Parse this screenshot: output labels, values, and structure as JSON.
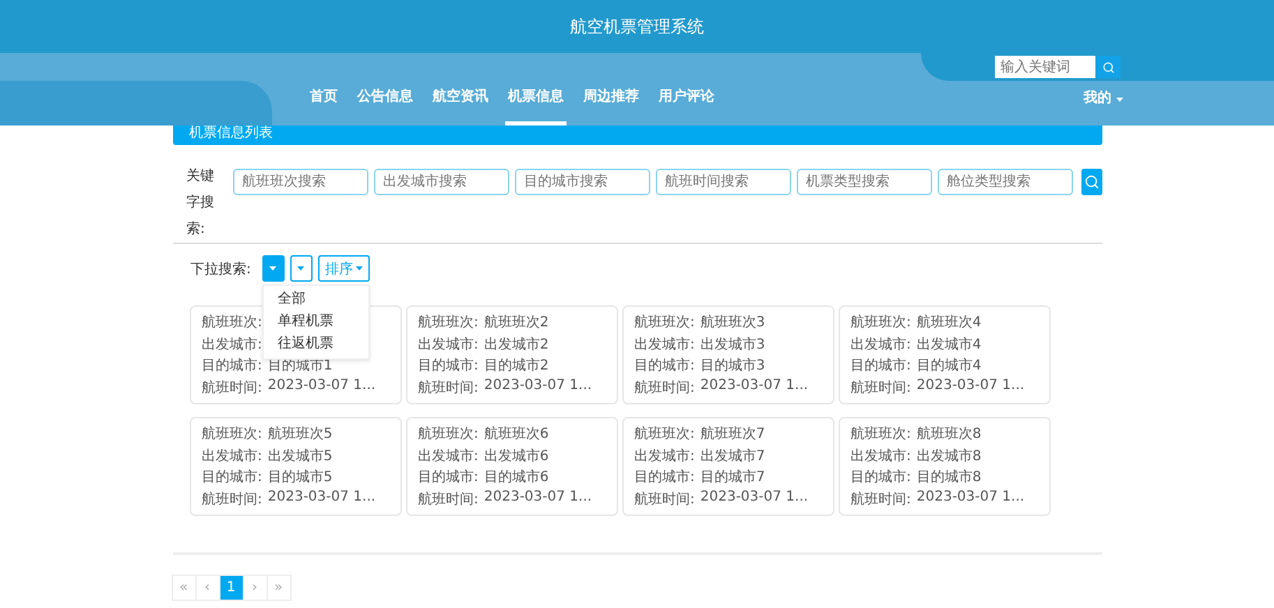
{
  "header": {
    "title": "航空机票管理系统"
  },
  "nav": {
    "items": [
      {
        "label": "首页",
        "selected": false
      },
      {
        "label": "公告信息",
        "selected": false
      },
      {
        "label": "航空资讯",
        "selected": false
      },
      {
        "label": "机票信息",
        "selected": true
      },
      {
        "label": "周边推荐",
        "selected": false
      },
      {
        "label": "用户评论",
        "selected": false
      }
    ],
    "search": {
      "placeholder": "输入关键词"
    },
    "user_menu": {
      "label": "我的"
    }
  },
  "panel": {
    "title": "机票信息列表"
  },
  "keyword_search": {
    "label": "关键字搜索:",
    "fields": [
      {
        "placeholder": "航班班次搜索"
      },
      {
        "placeholder": "出发城市搜索"
      },
      {
        "placeholder": "目的城市搜索"
      },
      {
        "placeholder": "航班时间搜索"
      },
      {
        "placeholder": "机票类型搜索"
      },
      {
        "placeholder": "舱位类型搜索"
      }
    ]
  },
  "dropdown_search": {
    "label": "下拉搜索:",
    "dropdowns": [
      {
        "expanded": true,
        "menu": [
          "全部",
          "单程机票",
          "往返机票"
        ]
      },
      {
        "expanded": false
      },
      {
        "label": "排序",
        "expanded": false
      }
    ]
  },
  "cards": [
    {
      "fields": [
        {
          "label": "航班班次:"
        },
        {
          "label": "出发城市:"
        },
        {
          "label": "目的城市:",
          "value": "目的城市1"
        },
        {
          "label": "航班时间:",
          "value": "2023-03-07 1..."
        }
      ]
    },
    {
      "fields": [
        {
          "label": "航班班次:",
          "value": "航班班次2"
        },
        {
          "label": "出发城市:",
          "value": "出发城市2"
        },
        {
          "label": "目的城市:",
          "value": "目的城市2"
        },
        {
          "label": "航班时间:",
          "value": "2023-03-07 1..."
        }
      ]
    },
    {
      "fields": [
        {
          "label": "航班班次:",
          "value": "航班班次3"
        },
        {
          "label": "出发城市:",
          "value": "出发城市3"
        },
        {
          "label": "目的城市:",
          "value": "目的城市3"
        },
        {
          "label": "航班时间:",
          "value": "2023-03-07 1..."
        }
      ]
    },
    {
      "fields": [
        {
          "label": "航班班次:",
          "value": "航班班次4"
        },
        {
          "label": "出发城市:",
          "value": "出发城市4"
        },
        {
          "label": "目的城市:",
          "value": "目的城市4"
        },
        {
          "label": "航班时间:",
          "value": "2023-03-07 1..."
        }
      ]
    },
    {
      "fields": [
        {
          "label": "航班班次:",
          "value": "航班班次5"
        },
        {
          "label": "出发城市:",
          "value": "出发城市5"
        },
        {
          "label": "目的城市:",
          "value": "目的城市5"
        },
        {
          "label": "航班时间:",
          "value": "2023-03-07 1..."
        }
      ]
    },
    {
      "fields": [
        {
          "label": "航班班次:",
          "value": "航班班次6"
        },
        {
          "label": "出发城市:",
          "value": "出发城市6"
        },
        {
          "label": "目的城市:",
          "value": "目的城市6"
        },
        {
          "label": "航班时间:",
          "value": "2023-03-07 1..."
        }
      ]
    },
    {
      "fields": [
        {
          "label": "航班班次:",
          "value": "航班班次7"
        },
        {
          "label": "出发城市:",
          "value": "出发城市7"
        },
        {
          "label": "目的城市:",
          "value": "目的城市7"
        },
        {
          "label": "航班时间:",
          "value": "2023-03-07 1..."
        }
      ]
    },
    {
      "fields": [
        {
          "label": "航班班次:",
          "value": "航班班次8"
        },
        {
          "label": "出发城市:",
          "value": "出发城市8"
        },
        {
          "label": "目的城市:",
          "value": "目的城市8"
        },
        {
          "label": "航班时间:",
          "value": "2023-03-07 1..."
        }
      ]
    }
  ],
  "pagination": [
    {
      "label": "«",
      "selected": false
    },
    {
      "label": "‹",
      "selected": false
    },
    {
      "label": "1",
      "selected": true
    },
    {
      "label": "›",
      "selected": false
    },
    {
      "label": "»",
      "selected": false
    }
  ]
}
